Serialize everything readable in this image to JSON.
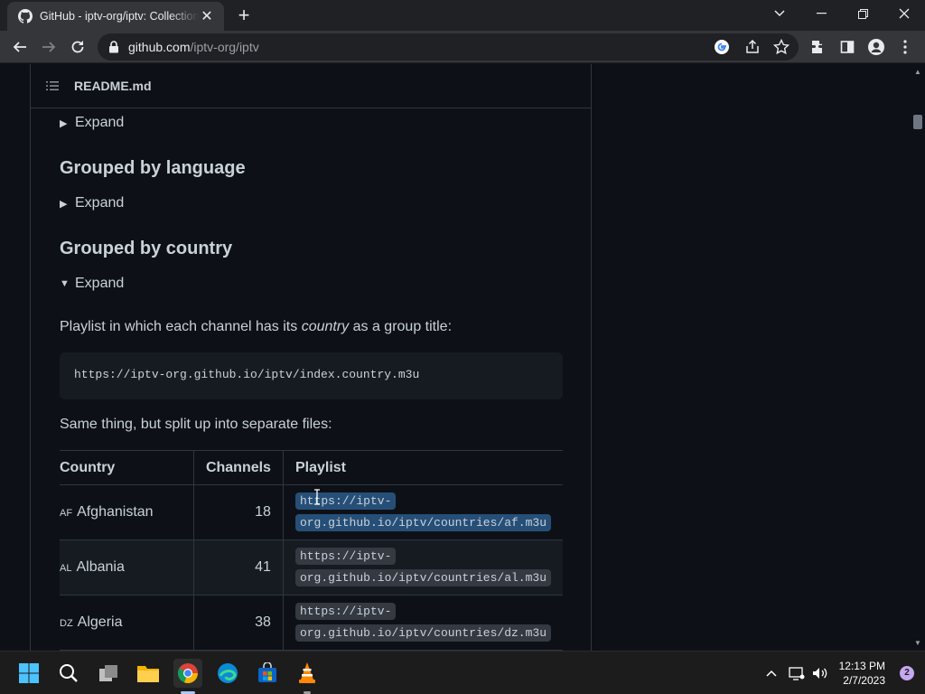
{
  "browser": {
    "tab_title": "GitHub - iptv-org/iptv: Collection of publicly available IPTV channels",
    "url_host": "github.com",
    "url_path": "/iptv-org/iptv"
  },
  "readme": {
    "file_name": "README.md",
    "expand_label": "Expand",
    "heading_language": "Grouped by language",
    "heading_country": "Grouped by country",
    "intro_before": "Playlist in which each channel has its ",
    "intro_em": "country",
    "intro_after": " as a group title:",
    "playlist_url": "https://iptv-org.github.io/iptv/index.country.m3u",
    "split_text": "Same thing, but split up into separate files:",
    "table": {
      "headers": [
        "Country",
        "Channels",
        "Playlist"
      ],
      "rows": [
        {
          "code": "AF",
          "country": "Afghanistan",
          "channels": "18",
          "line1": "https://iptv-",
          "line2": "org.github.io/iptv/countries/af.m3u"
        },
        {
          "code": "AL",
          "country": "Albania",
          "channels": "41",
          "line1": "https://iptv-",
          "line2": "org.github.io/iptv/countries/al.m3u"
        },
        {
          "code": "DZ",
          "country": "Algeria",
          "channels": "38",
          "line1": "https://iptv-",
          "line2": "org.github.io/iptv/countries/dz.m3u"
        }
      ]
    }
  },
  "taskbar": {
    "time": "12:13 PM",
    "date": "2/7/2023",
    "notifications": "2"
  }
}
